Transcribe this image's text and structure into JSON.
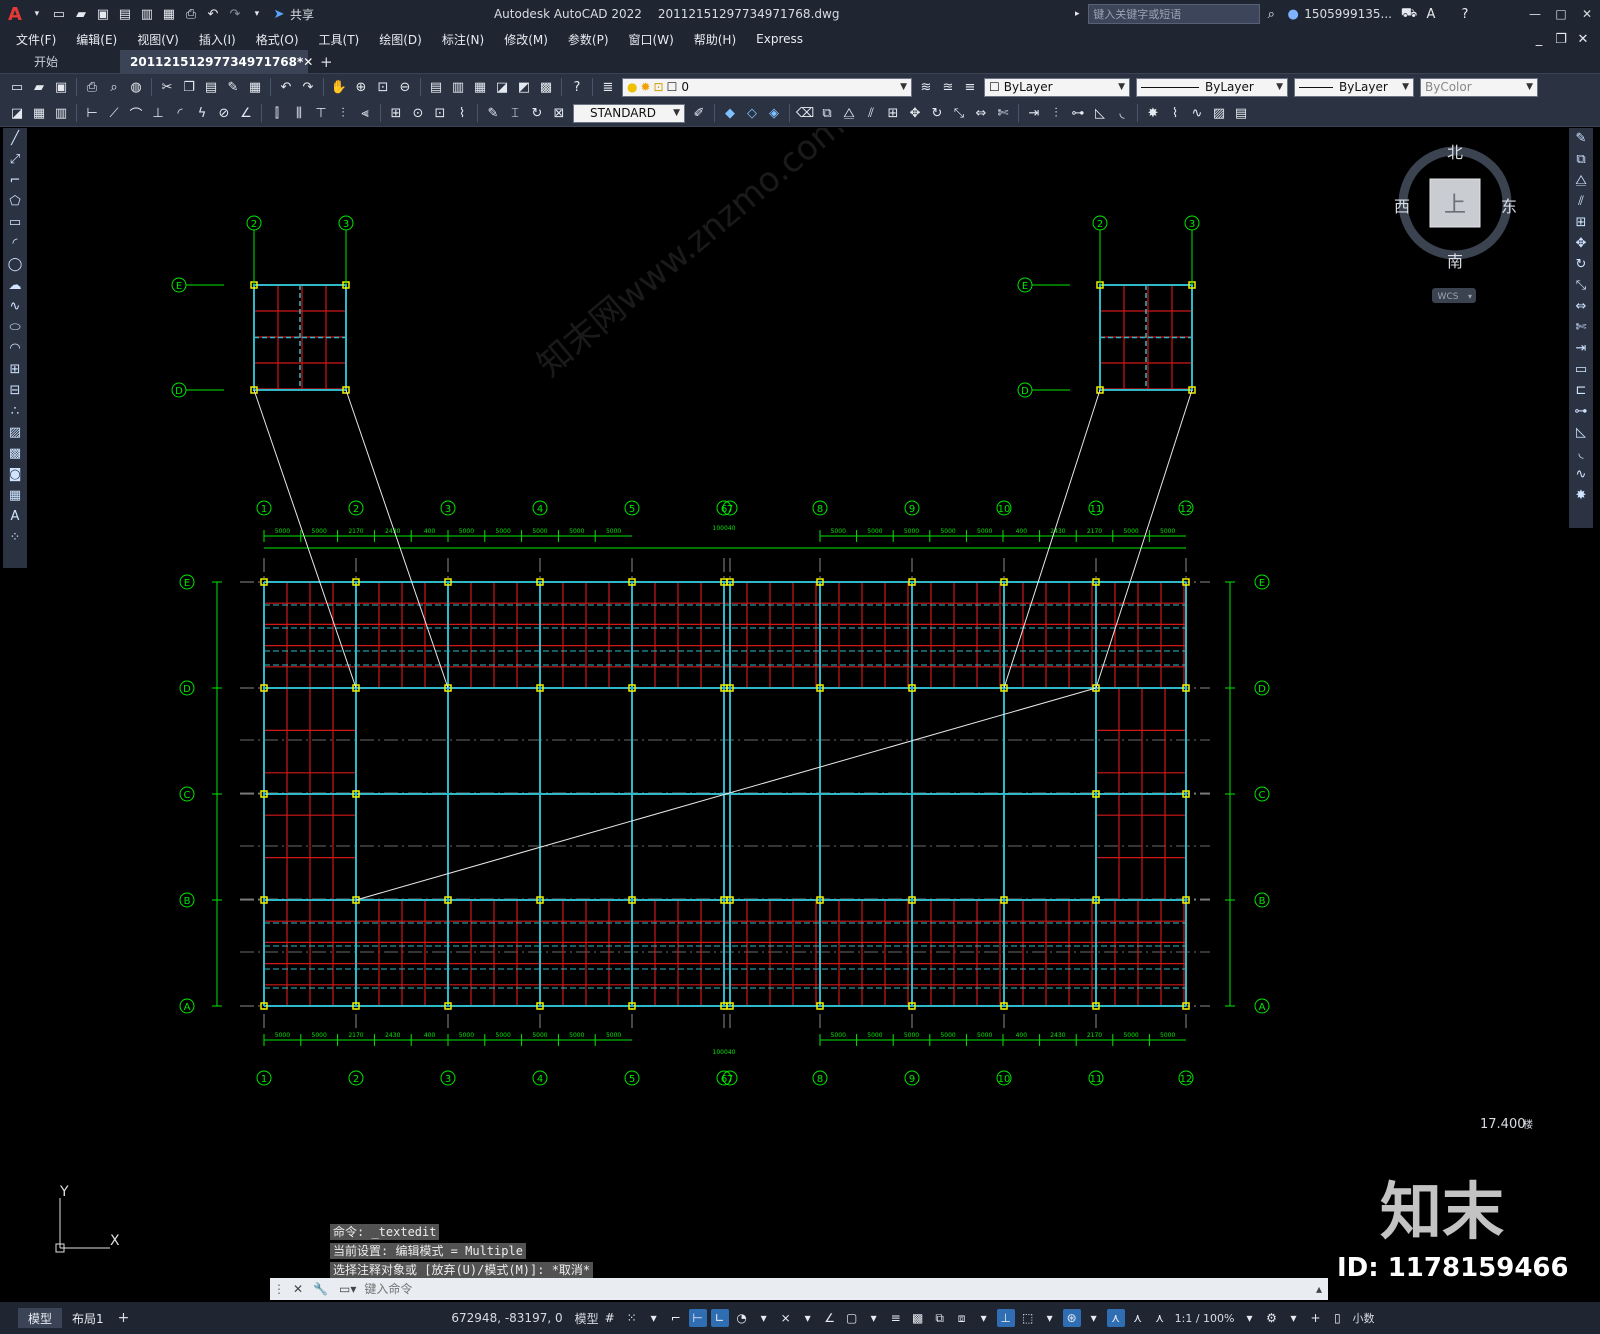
{
  "app": {
    "logo": "A",
    "title": "Autodesk AutoCAD 2022",
    "filename": "20112151297734971768.dwg",
    "share_label": "共享",
    "search_placeholder": "键入关键字或短语",
    "user": "1505999135...",
    "window_buttons": [
      "—",
      "□",
      "✕"
    ]
  },
  "menu": [
    "文件(F)",
    "编辑(E)",
    "视图(V)",
    "插入(I)",
    "格式(O)",
    "工具(T)",
    "绘图(D)",
    "标注(N)",
    "修改(M)",
    "参数(P)",
    "窗口(W)",
    "帮助(H)",
    "Express"
  ],
  "tabs": [
    {
      "label": "开始"
    },
    {
      "label": "20112151297734971768*"
    }
  ],
  "toolbar": {
    "layer_value": "0",
    "color": "ByLayer",
    "linetype": "ByLayer",
    "lineweight": "ByLayer",
    "plotstyle": "ByColor",
    "text_style": "STANDARD"
  },
  "viewcube": {
    "north": "北",
    "south": "南",
    "east": "东",
    "west": "西",
    "face": "上",
    "wcs": "WCS"
  },
  "drawing": {
    "col_labels": [
      "1",
      "2",
      "3",
      "4",
      "5",
      "6",
      "7",
      "8",
      "9",
      "10",
      "11",
      "12"
    ],
    "row_labels": [
      "E",
      "D",
      "C",
      "B",
      "A"
    ],
    "dim_left": [
      "5000",
      "5000",
      "2170",
      "2430",
      "400",
      "5000",
      "5000",
      "5000",
      "5000",
      "5000"
    ],
    "dim_right": [
      "5000",
      "5000",
      "5000",
      "5000",
      "5000",
      "400",
      "2430",
      "2170",
      "5000",
      "5000"
    ],
    "dim_total": "100040",
    "detail_cols_left": [
      "2",
      "3"
    ],
    "detail_cols_right": [
      "2",
      "3"
    ],
    "detail_rows": [
      "E",
      "D"
    ],
    "elevation": "17.400",
    "elevation_suffix": "楼"
  },
  "ucs": {
    "x": "X",
    "y": "Y"
  },
  "command_history": [
    "命令: _textedit",
    "当前设置: 编辑模式 = Multiple",
    "选择注释对象或 [放弃(U)/模式(M)]: *取消*"
  ],
  "command_placeholder": "键入命令",
  "status": {
    "tab_model": "模型",
    "tab_layout": "布局1",
    "coords": "672948, -83197, 0",
    "space": "模型",
    "scale": "1:1 / 100%",
    "units": "小数"
  },
  "watermark": {
    "brand": "知末",
    "id": "ID: 1178159466",
    "site": "知末网www.znzmo.com"
  },
  "colors": {
    "grid_axis": "#00e600",
    "beam_red": "#d01818",
    "column_cyan": "#2fb8c8",
    "node_yellow": "#f0f000"
  }
}
